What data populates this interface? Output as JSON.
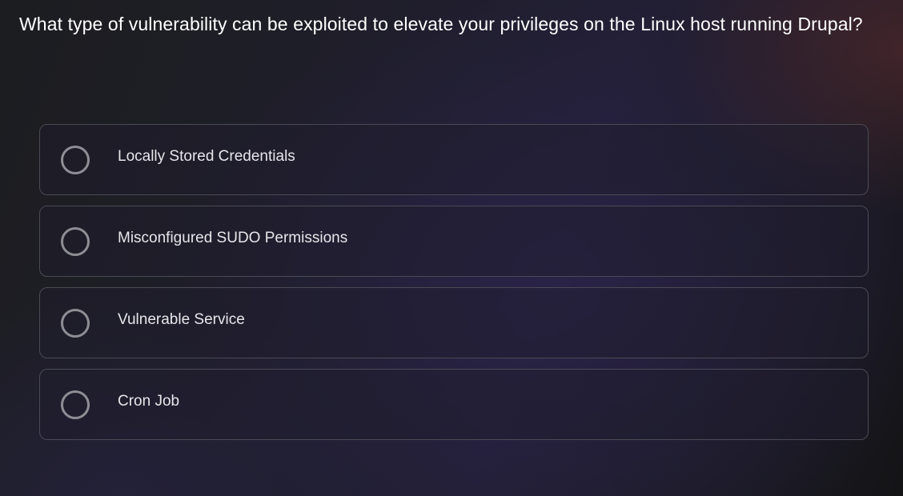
{
  "question": {
    "text": "What type of vulnerability can be exploited to elevate your privileges on the Linux host running Drupal?"
  },
  "options": [
    {
      "label": "Locally Stored Credentials",
      "selected": false
    },
    {
      "label": "Misconfigured SUDO Permissions",
      "selected": false
    },
    {
      "label": "Vulnerable Service",
      "selected": false
    },
    {
      "label": "Cron Job",
      "selected": false
    }
  ],
  "colors": {
    "border": "#4a4a55",
    "radio_ring": "#8e8e95",
    "text": "#ffffff"
  }
}
